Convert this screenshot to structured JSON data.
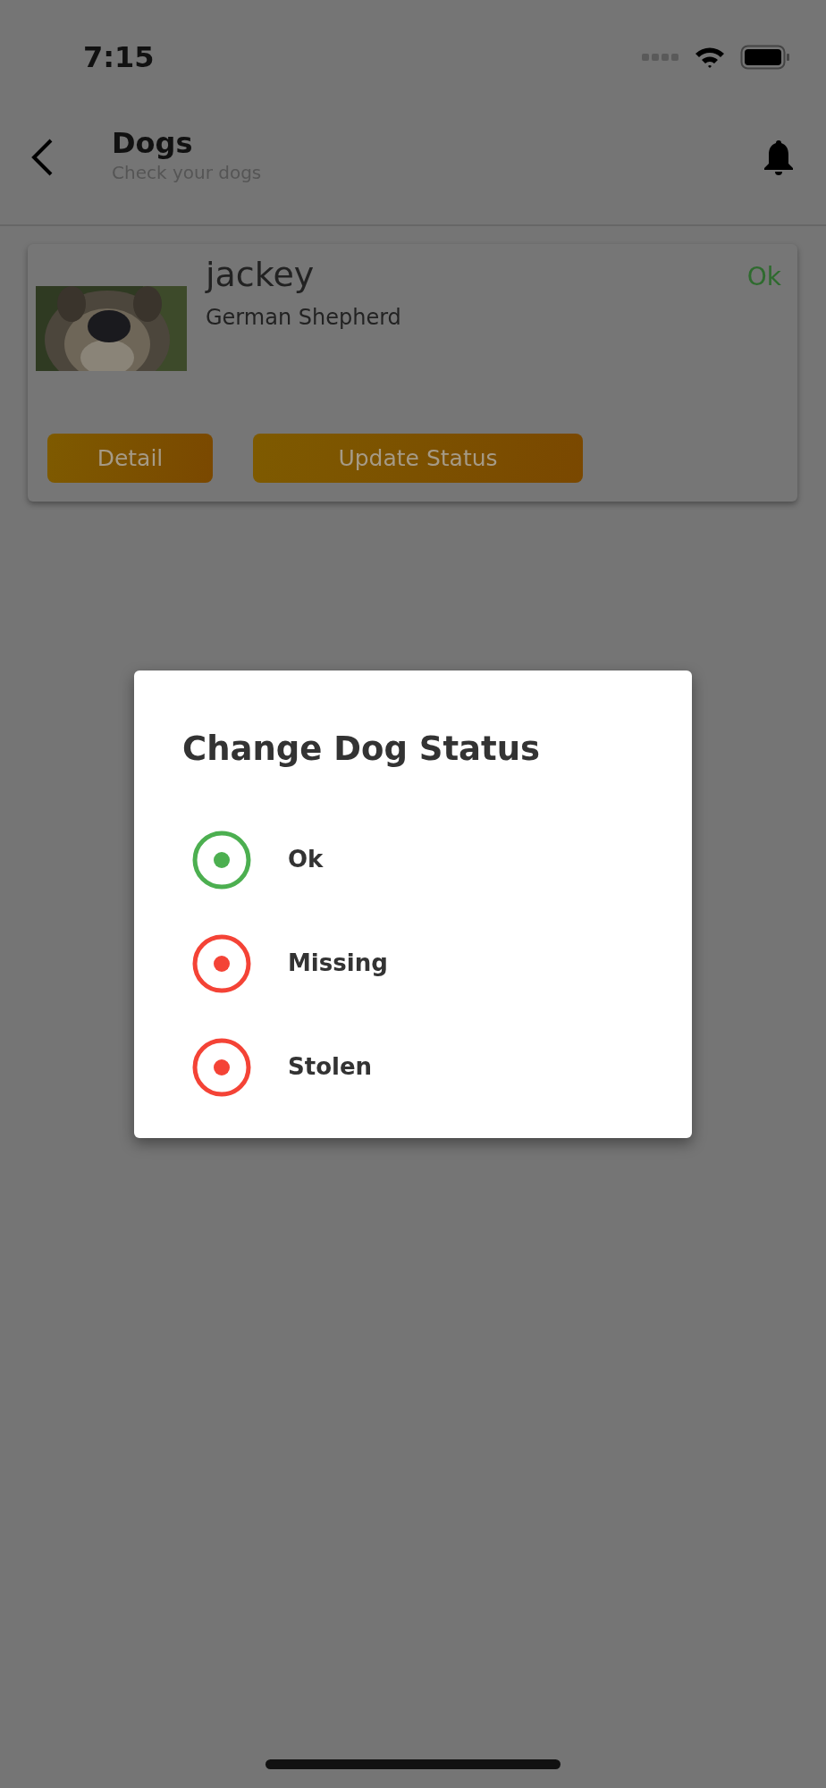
{
  "status_bar": {
    "time": "7:15"
  },
  "header": {
    "title": "Dogs",
    "subtitle": "Check your dogs"
  },
  "dogs": [
    {
      "name": "jackey",
      "breed": "German Shepherd",
      "status": "Ok",
      "photo": {
        "kind": "picture"
      },
      "buttons": [
        "Detail",
        "Update Status"
      ]
    }
  ],
  "dialog": {
    "title": "Change Dog Status",
    "options": [
      {
        "label": "Ok",
        "color": "#4caf50",
        "selected": true
      },
      {
        "label": "Missing",
        "color": "#f44336",
        "selected": true
      },
      {
        "label": "Stolen",
        "color": "#f44336",
        "selected": true
      }
    ]
  }
}
